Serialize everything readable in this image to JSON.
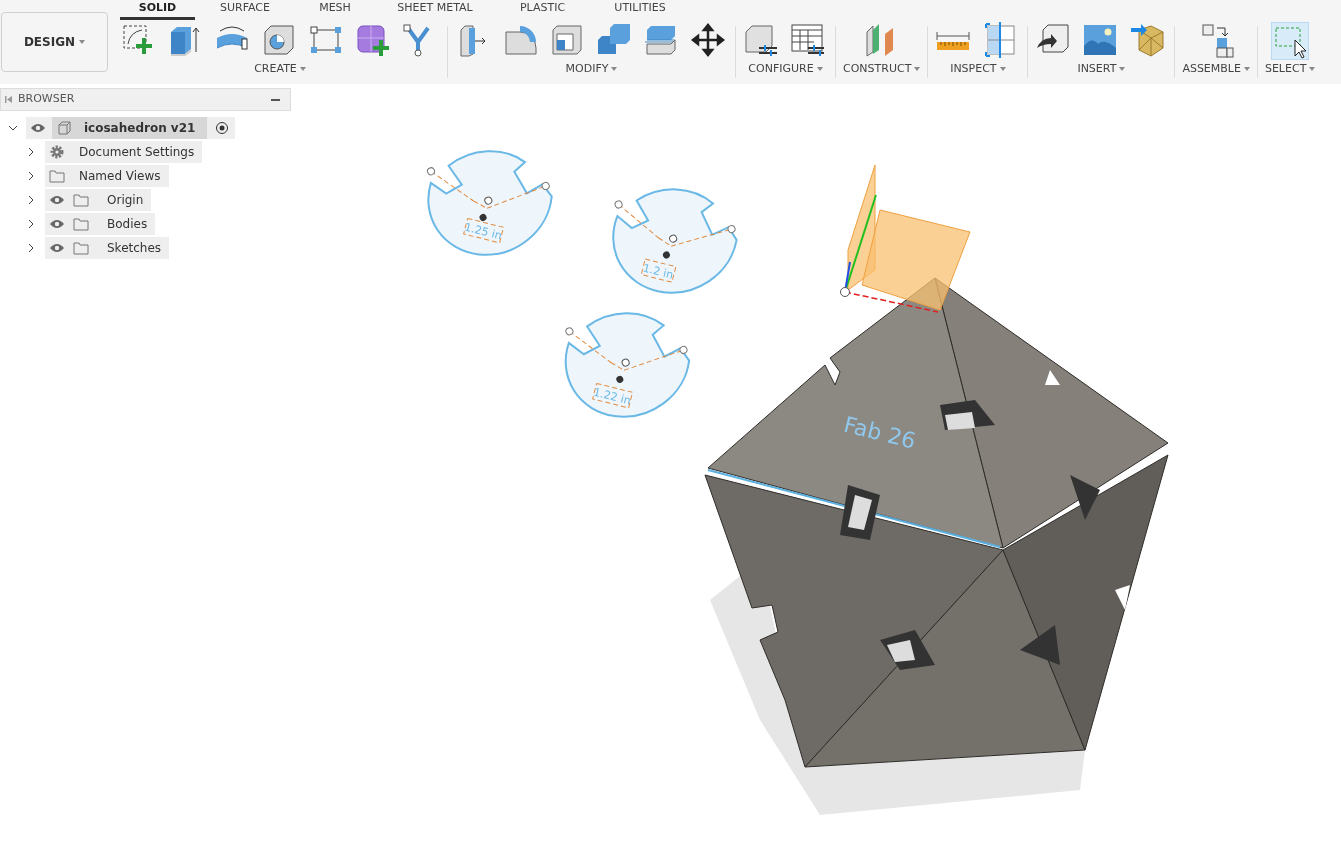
{
  "workspace_button": {
    "label": "DESIGN"
  },
  "tabs": [
    {
      "label": "SOLID",
      "selected": true
    },
    {
      "label": "SURFACE",
      "selected": false
    },
    {
      "label": "MESH",
      "selected": false
    },
    {
      "label": "SHEET METAL",
      "selected": false
    },
    {
      "label": "PLASTIC",
      "selected": false
    },
    {
      "label": "UTILITIES",
      "selected": false
    }
  ],
  "tool_groups": [
    {
      "label": "CREATE"
    },
    {
      "label": "MODIFY"
    },
    {
      "label": "CONFIGURE"
    },
    {
      "label": "CONSTRUCT"
    },
    {
      "label": "INSPECT"
    },
    {
      "label": "INSERT"
    },
    {
      "label": "ASSEMBLE"
    },
    {
      "label": "SELECT"
    }
  ],
  "browser": {
    "title": "BROWSER",
    "root": {
      "label": "icosahedron v21",
      "expanded": true,
      "visible": true,
      "children": [
        {
          "label": "Document Settings",
          "kind": "settings",
          "expanded": false
        },
        {
          "label": "Named Views",
          "kind": "folder",
          "expanded": false
        },
        {
          "label": "Origin",
          "kind": "folder",
          "expanded": false,
          "visible": true
        },
        {
          "label": "Bodies",
          "kind": "folder",
          "expanded": false,
          "visible": true
        },
        {
          "label": "Sketches",
          "kind": "folder",
          "expanded": false,
          "visible": true
        }
      ]
    }
  },
  "viewport": {
    "sketch_dimensions": [
      "1.25 in",
      "1.2 in",
      "1.22 in"
    ],
    "body_label": "Fab 26"
  }
}
